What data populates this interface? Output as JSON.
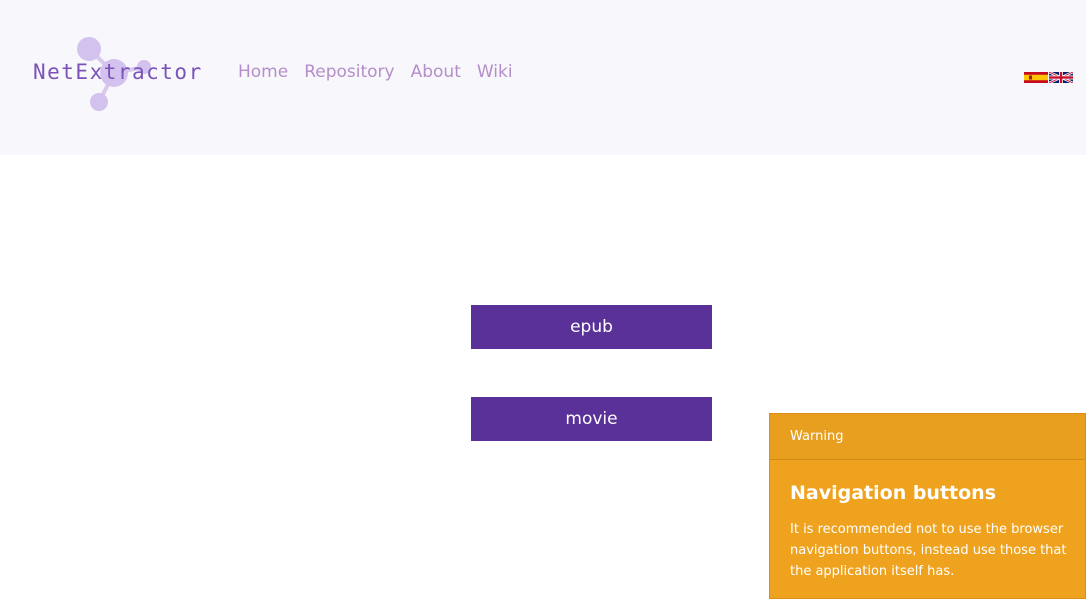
{
  "header": {
    "logo_text": "NetExtractor",
    "nav": [
      "Home",
      "Repository",
      "About",
      "Wiki"
    ],
    "languages": [
      "es",
      "en"
    ]
  },
  "main": {
    "buttons": [
      "epub",
      "movie"
    ]
  },
  "toast": {
    "header": "Warning",
    "title": "Navigation buttons",
    "body": "It is recommended not to use the browser navigation buttons, instead use those that the application itself has."
  },
  "colors": {
    "header_bg": "#f8f7fc",
    "nav_link": "#b48ec9",
    "button_bg": "#5a3198",
    "toast_bg": "#efa21e"
  }
}
